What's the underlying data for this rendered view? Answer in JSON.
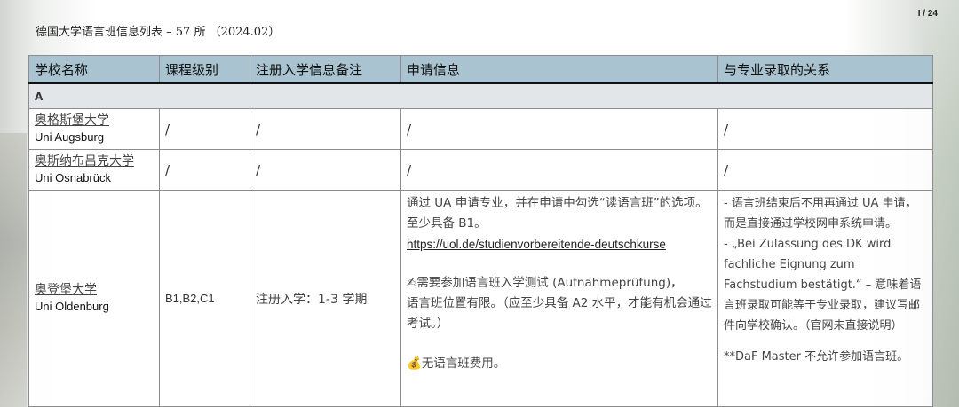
{
  "page_number": "I / 24",
  "title": "德国大学语言班信息列表 – 57 所 （2024.02）",
  "columns": [
    "学校名称",
    "课程级别",
    "注册入学信息备注",
    "申请信息",
    "与专业录取的关系"
  ],
  "section_label": "A",
  "rows": [
    {
      "name_cn": "奥格斯堡大学",
      "name_en": "Uni Augsburg",
      "level": "/",
      "enrollment": "/",
      "application": "/",
      "relation": "/"
    },
    {
      "name_cn": "奥斯纳布吕克大学",
      "name_en": "Uni Osnabrück",
      "level": "/",
      "enrollment": "/",
      "application": "/",
      "relation": "/"
    },
    {
      "name_cn": "奥登堡大学",
      "name_en": "Uni Oldenburg",
      "level": "B1,B2,C1",
      "enrollment": "注册入学：1-3 学期",
      "application": {
        "p1": "通过 UA 申请专业，并在申请中勾选“读语言班”的选项。至少具备 B1。",
        "link": "https://uol.de/studienvorbereitende-deutschkurse",
        "test_icon": "✍",
        "test": "需要参加语言班入学测试 (Aufnahmeprüfung)，",
        "limit": "语言班位置有限。（应至少具备 A2 水平，才能有机会通过考试。）",
        "fee_icon": "💰",
        "fee": "无语言班费用。"
      },
      "relation": {
        "p1": "- 语言班结束后不用再通过 UA 申请，而是直接通过学校网申系统申请。",
        "p2": "- „Bei Zulassung des DK wird fachliche Eignung zum Fachstudium bestätigt.“ – 意味着语言班录取可能等于专业录取，建议写邮件向学校确认。（官网未直接说明）",
        "p3": "**DaF Master 不允许参加语言班。"
      }
    }
  ]
}
